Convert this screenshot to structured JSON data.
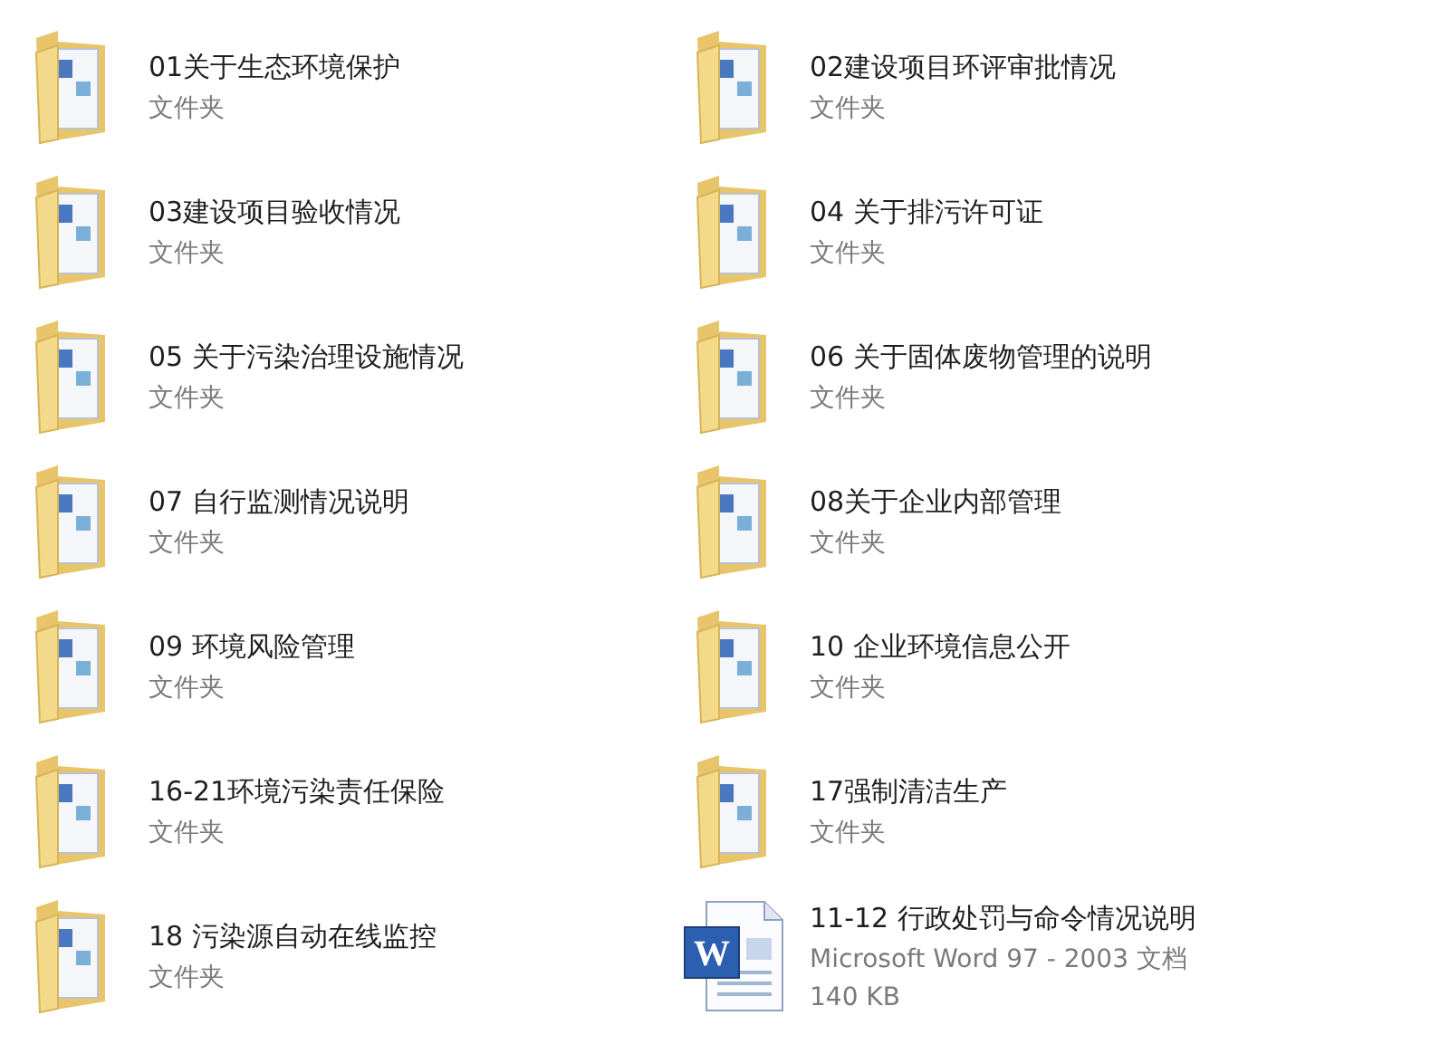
{
  "items": [
    {
      "kind": "folder",
      "name": "01关于生态环境保护",
      "details": [
        "文件夹"
      ]
    },
    {
      "kind": "folder",
      "name": "02建设项目环评审批情况",
      "details": [
        "文件夹"
      ]
    },
    {
      "kind": "folder",
      "name": "03建设项目验收情况",
      "details": [
        "文件夹"
      ]
    },
    {
      "kind": "folder",
      "name": "04 关于排污许可证",
      "details": [
        "文件夹"
      ]
    },
    {
      "kind": "folder",
      "name": "05 关于污染治理设施情况",
      "details": [
        "文件夹"
      ]
    },
    {
      "kind": "folder",
      "name": "06 关于固体废物管理的说明",
      "details": [
        "文件夹"
      ]
    },
    {
      "kind": "folder",
      "name": "07 自行监测情况说明",
      "details": [
        "文件夹"
      ]
    },
    {
      "kind": "folder",
      "name": "08关于企业内部管理",
      "details": [
        "文件夹"
      ]
    },
    {
      "kind": "folder",
      "name": "09 环境风险管理",
      "details": [
        "文件夹"
      ]
    },
    {
      "kind": "folder",
      "name": "10 企业环境信息公开",
      "details": [
        "文件夹"
      ]
    },
    {
      "kind": "folder",
      "name": "16-21环境污染责任保险",
      "details": [
        "文件夹"
      ]
    },
    {
      "kind": "folder",
      "name": "17强制清洁生产",
      "details": [
        "文件夹"
      ]
    },
    {
      "kind": "folder",
      "name": "18 污染源自动在线监控",
      "details": [
        "文件夹"
      ]
    },
    {
      "kind": "document",
      "icon_letter": "W",
      "name": "11-12 行政处罚与命令情况说明",
      "details": [
        "Microsoft Word 97 - 2003 文档",
        "140 KB"
      ]
    }
  ]
}
